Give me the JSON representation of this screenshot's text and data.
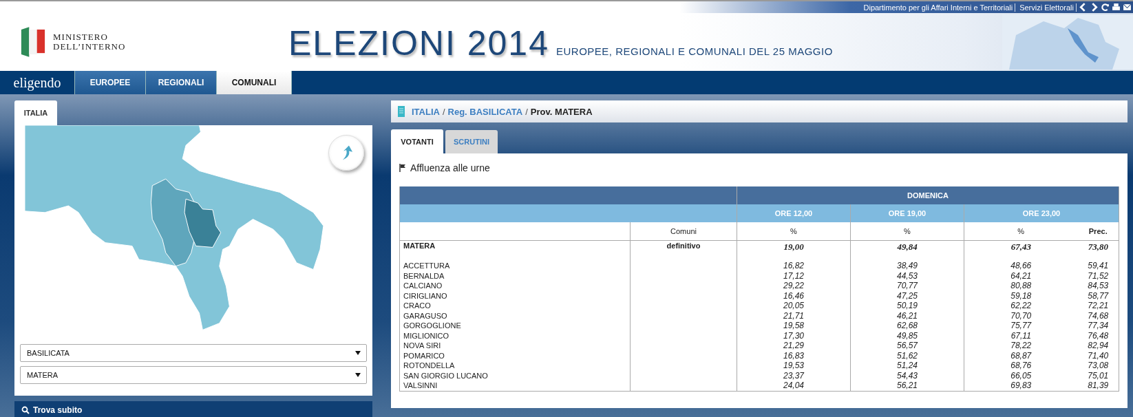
{
  "top_links": [
    "Dipartimento per gli Affari Interni e Territoriali",
    "Servizi Elettorali"
  ],
  "logo": {
    "lines": [
      "MINISTERO",
      "DELL’INTERNO"
    ]
  },
  "title": "ELEZIONI 2014",
  "subtitle": "EUROPEE, REGIONALI E COMUNALI DEL 25 MAGGIO",
  "brand": "eligendo",
  "nav_tabs": [
    {
      "label": "EUROPEE",
      "selected": false
    },
    {
      "label": "REGIONALI",
      "selected": false
    },
    {
      "label": "COMUNALI",
      "selected": true
    }
  ],
  "left_panel": {
    "tab": "ITALIA",
    "selects": [
      "BASILICATA",
      "MATERA"
    ],
    "search_bar": "Trova subito"
  },
  "breadcrumb_separator": "/",
  "breadcrumb": [
    {
      "label": "ITALIA",
      "kind": "link"
    },
    {
      "label": "Reg. BASILICATA",
      "kind": "link"
    },
    {
      "label": "Prov. MATERA",
      "kind": "current"
    }
  ],
  "content_tabs": [
    {
      "label": "VOTANTI",
      "selected": true
    },
    {
      "label": "SCRUTINI",
      "selected": false
    }
  ],
  "section_title": "Affluenza alle urne",
  "table": {
    "day": "DOMENICA",
    "times": [
      "ORE 12,00",
      "ORE 19,00",
      "ORE 23,00"
    ],
    "columns": [
      "Comuni",
      "%",
      "%",
      "%",
      "Prec."
    ],
    "total": {
      "name": "MATERA",
      "status": "definitivo",
      "values": [
        "19,00",
        "49,84",
        "67,43",
        "73,80"
      ]
    },
    "rows": [
      {
        "name": "ACCETTURA",
        "values": [
          "16,82",
          "38,49",
          "48,66",
          "59,41"
        ]
      },
      {
        "name": "BERNALDA",
        "values": [
          "17,12",
          "44,53",
          "64,21",
          "71,52"
        ]
      },
      {
        "name": "CALCIANO",
        "values": [
          "29,22",
          "70,77",
          "80,88",
          "84,53"
        ]
      },
      {
        "name": "CIRIGLIANO",
        "values": [
          "16,46",
          "47,25",
          "59,18",
          "58,77"
        ]
      },
      {
        "name": "CRACO",
        "values": [
          "20,05",
          "50,19",
          "62,22",
          "72,21"
        ]
      },
      {
        "name": "GARAGUSO",
        "values": [
          "21,71",
          "46,21",
          "70,70",
          "74,68"
        ]
      },
      {
        "name": "GORGOGLIONE",
        "values": [
          "19,58",
          "62,68",
          "75,77",
          "77,34"
        ]
      },
      {
        "name": "MIGLIONICO",
        "values": [
          "17,30",
          "49,85",
          "67,11",
          "76,48"
        ]
      },
      {
        "name": "NOVA SIRI",
        "values": [
          "21,29",
          "56,57",
          "78,22",
          "82,94"
        ]
      },
      {
        "name": "POMARICO",
        "values": [
          "16,83",
          "51,62",
          "68,87",
          "71,40"
        ]
      },
      {
        "name": "ROTONDELLA",
        "values": [
          "19,53",
          "51,24",
          "68,76",
          "73,08"
        ]
      },
      {
        "name": "SAN GIORGIO LUCANO",
        "values": [
          "23,37",
          "54,43",
          "66,05",
          "75,01"
        ]
      },
      {
        "name": "VALSINNI",
        "values": [
          "24,04",
          "56,21",
          "69,83",
          "81,39"
        ]
      }
    ]
  }
}
